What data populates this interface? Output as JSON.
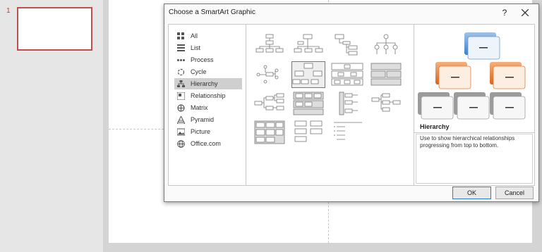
{
  "slide_thumbnails": [
    {
      "number": "1"
    }
  ],
  "dialog": {
    "title": "Choose a SmartArt Graphic",
    "help_label": "?",
    "close_icon": "close-icon",
    "categories": [
      {
        "label": "All",
        "icon": "grid-icon"
      },
      {
        "label": "List",
        "icon": "list-icon"
      },
      {
        "label": "Process",
        "icon": "process-icon"
      },
      {
        "label": "Cycle",
        "icon": "cycle-icon"
      },
      {
        "label": "Hierarchy",
        "icon": "hierarchy-icon",
        "selected": true
      },
      {
        "label": "Relationship",
        "icon": "relationship-icon"
      },
      {
        "label": "Matrix",
        "icon": "matrix-icon"
      },
      {
        "label": "Pyramid",
        "icon": "pyramid-icon"
      },
      {
        "label": "Picture",
        "icon": "picture-icon"
      },
      {
        "label": "Office.com",
        "icon": "globe-icon"
      }
    ],
    "gallery_selected_index": 5,
    "preview": {
      "name": "Hierarchy",
      "description": "Use to show hierarchical relationships progressing from top to bottom."
    },
    "ok_label": "OK",
    "cancel_label": "Cancel",
    "colors": {
      "accent_blue": "#5b9bd5",
      "accent_orange": "#ed7d31",
      "node_gray": "#a5a5a5"
    }
  }
}
